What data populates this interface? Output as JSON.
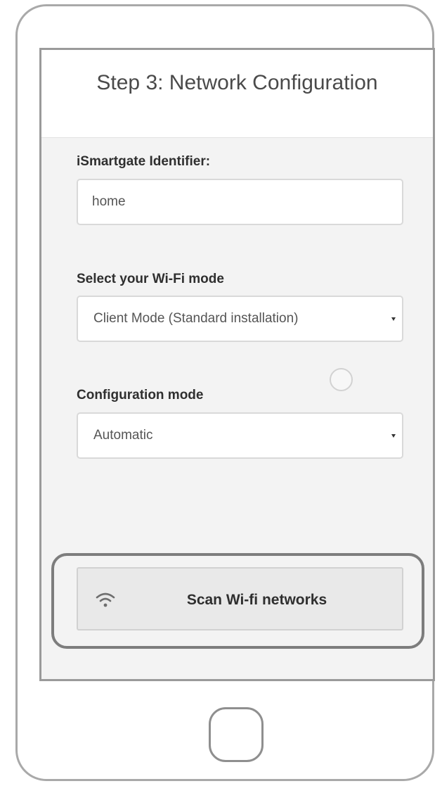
{
  "screen": {
    "title": "Step 3: Network Configuration"
  },
  "identifier": {
    "label": "iSmartgate Identifier:",
    "value": "home"
  },
  "wifi_mode": {
    "label": "Select your Wi-Fi mode",
    "selected": "Client Mode (Standard installation)"
  },
  "config_mode": {
    "label": "Configuration mode",
    "selected": "Automatic"
  },
  "scan_button": {
    "label": "Scan Wi-fi networks",
    "icon": "wifi-icon"
  },
  "colors": {
    "screen_background": "#f3f3f3",
    "button_background": "#e9e9e9",
    "highlight_frame": "#7d7d7d"
  }
}
